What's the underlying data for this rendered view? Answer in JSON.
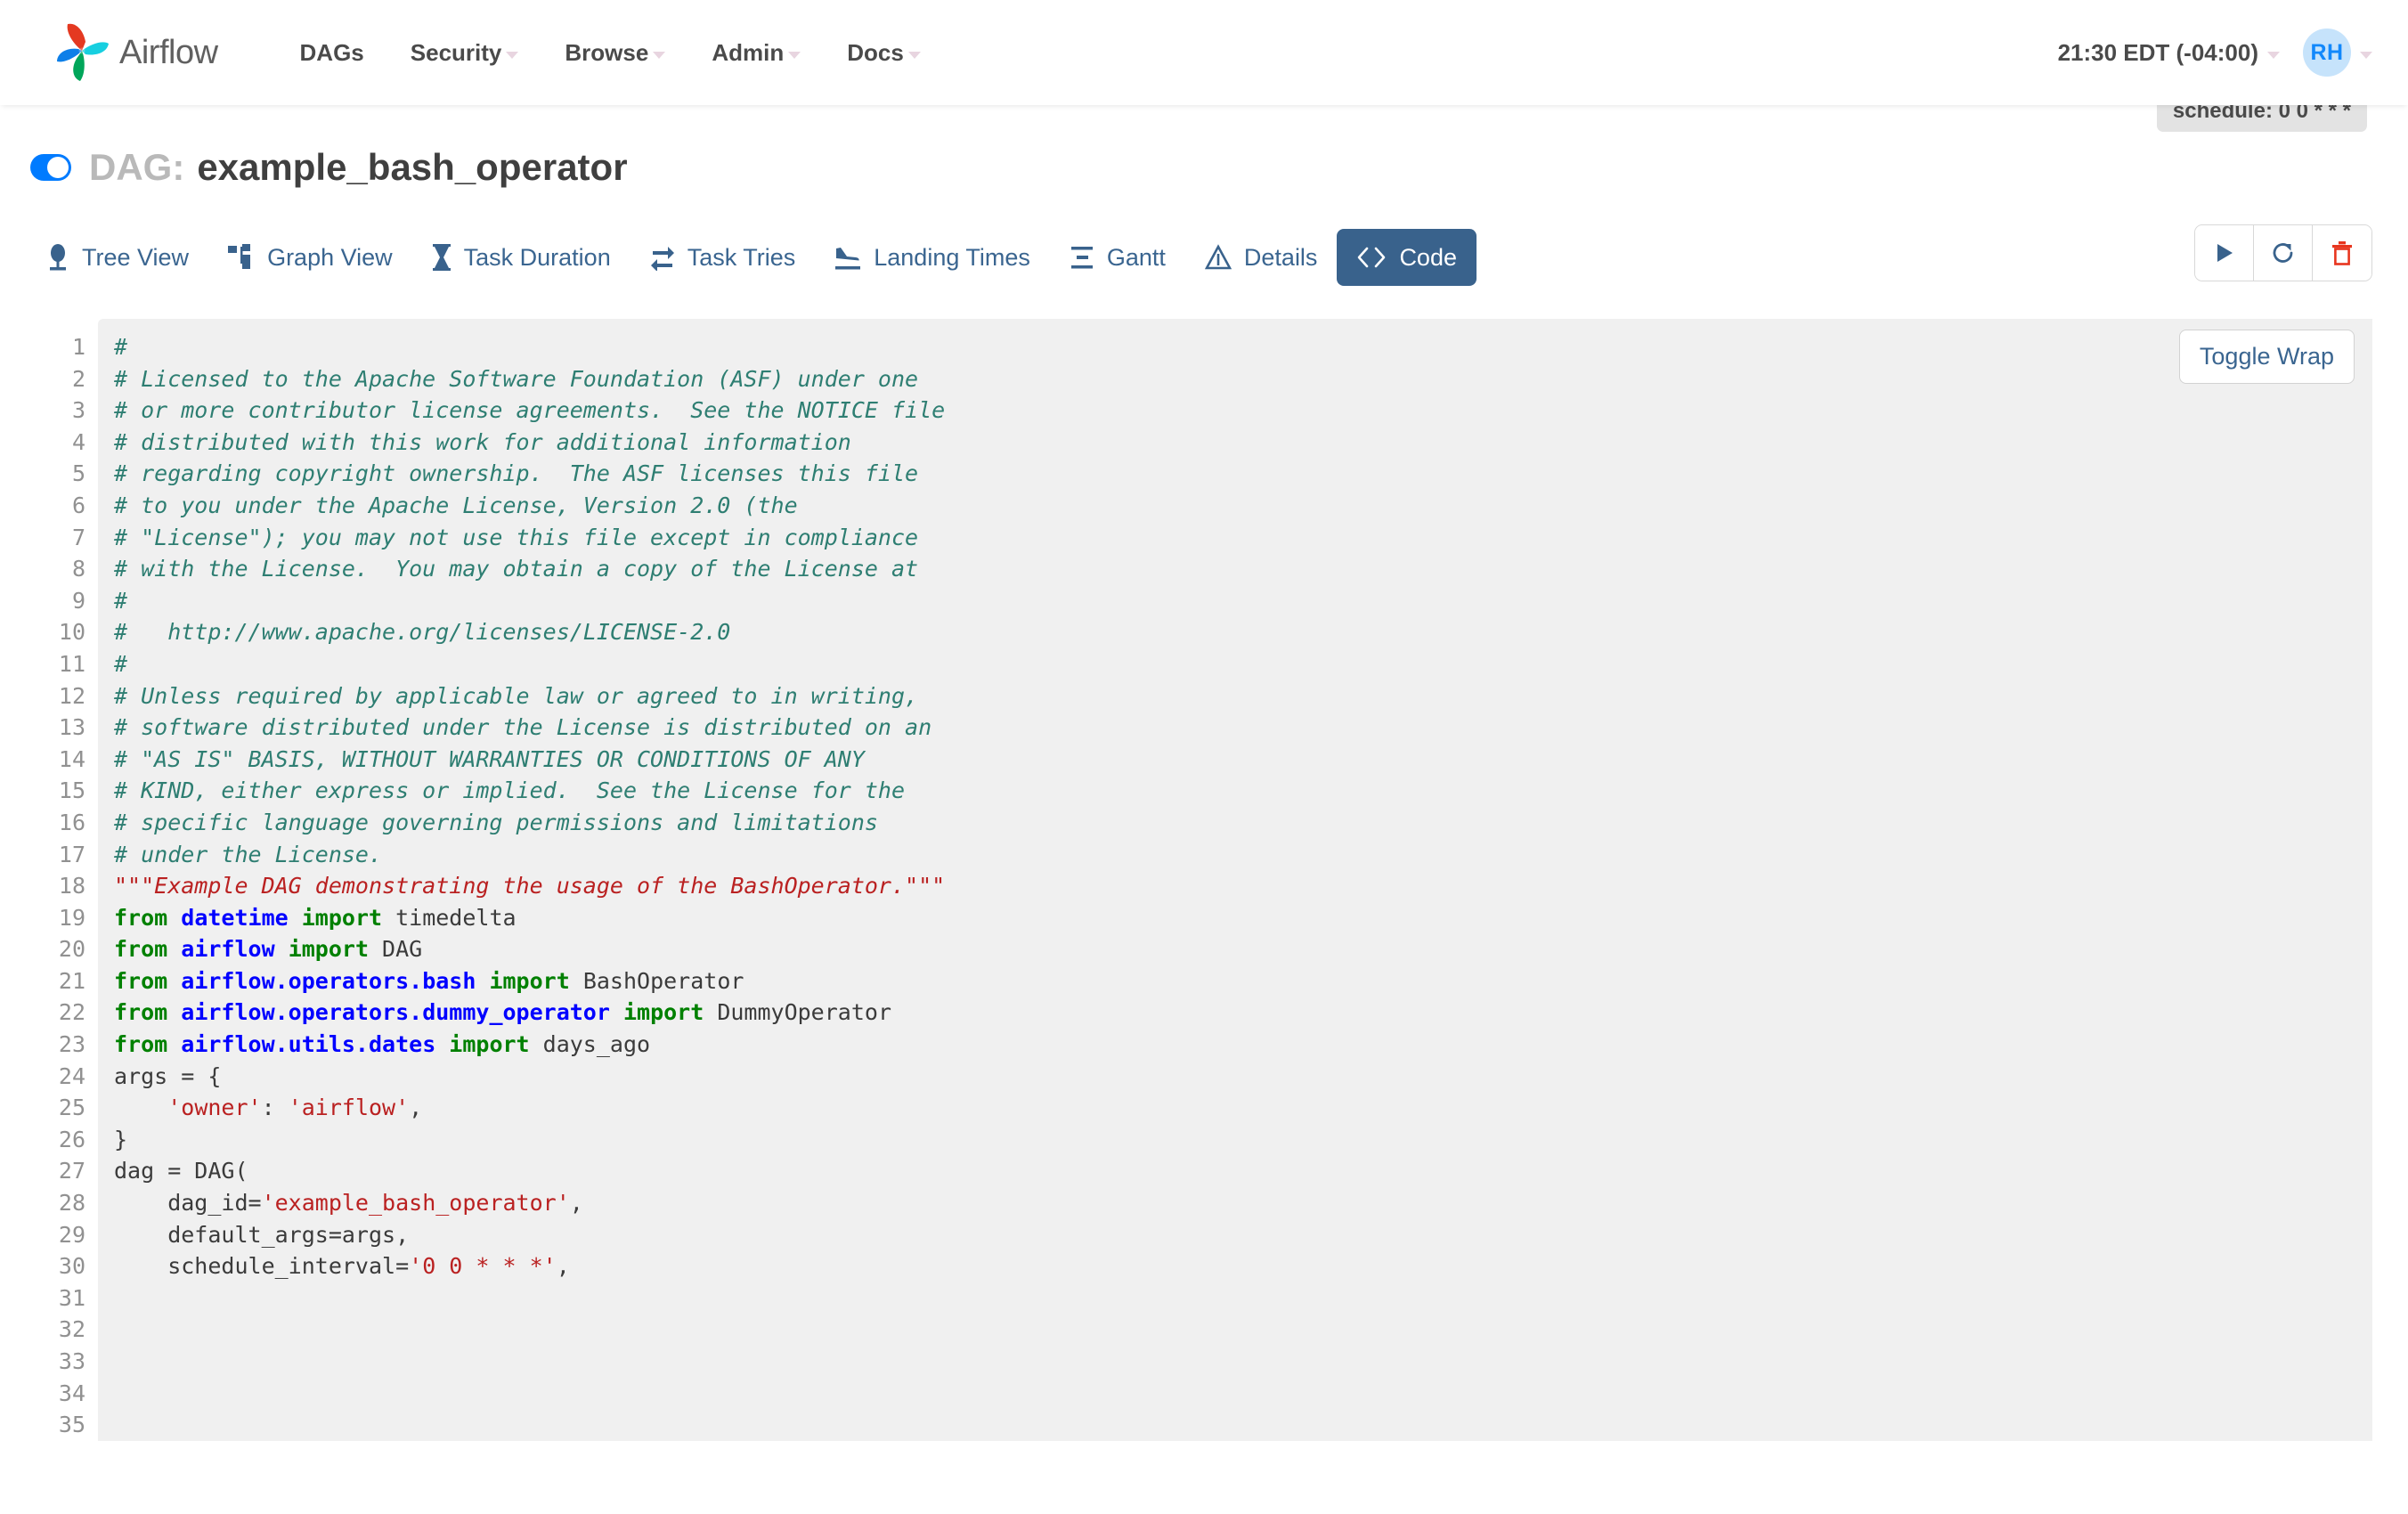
{
  "navbar": {
    "brand": "Airflow",
    "links": [
      {
        "label": "DAGs",
        "has_caret": false
      },
      {
        "label": "Security",
        "has_caret": true
      },
      {
        "label": "Browse",
        "has_caret": true
      },
      {
        "label": "Admin",
        "has_caret": true
      },
      {
        "label": "Docs",
        "has_caret": true
      }
    ],
    "timezone": "21:30 EDT (-04:00)",
    "avatar_initials": "RH"
  },
  "dag": {
    "prefix": "DAG:",
    "name": "example_bash_operator",
    "toggle_on": true,
    "schedule_badge": "schedule: 0 0 * * *"
  },
  "tabs": [
    {
      "label": "Tree View",
      "icon": "tree-icon",
      "active": false
    },
    {
      "label": "Graph View",
      "icon": "graph-icon",
      "active": false
    },
    {
      "label": "Task Duration",
      "icon": "hourglass-icon",
      "active": false
    },
    {
      "label": "Task Tries",
      "icon": "retry-icon",
      "active": false
    },
    {
      "label": "Landing Times",
      "icon": "plane-landing-icon",
      "active": false
    },
    {
      "label": "Gantt",
      "icon": "gantt-icon",
      "active": false
    },
    {
      "label": "Details",
      "icon": "warning-triangle-icon",
      "active": false
    },
    {
      "label": "Code",
      "icon": "code-brackets-icon",
      "active": true
    }
  ],
  "actions": [
    {
      "name": "trigger-dag-button",
      "icon": "play-icon",
      "color": "#39628c"
    },
    {
      "name": "refresh-button",
      "icon": "refresh-icon",
      "color": "#39628c"
    },
    {
      "name": "delete-dag-button",
      "icon": "trash-icon",
      "color": "#e8351e"
    }
  ],
  "code_panel": {
    "toggle_wrap_label": "Toggle Wrap",
    "first_line_number": 1,
    "last_line_number": 35,
    "lines": [
      {
        "n": 1,
        "tokens": [
          {
            "t": "#",
            "c": "c"
          }
        ]
      },
      {
        "n": 2,
        "tokens": [
          {
            "t": "# Licensed to the Apache Software Foundation (ASF) under one",
            "c": "c"
          }
        ]
      },
      {
        "n": 3,
        "tokens": [
          {
            "t": "# or more contributor license agreements.  See the NOTICE file",
            "c": "c"
          }
        ]
      },
      {
        "n": 4,
        "tokens": [
          {
            "t": "# distributed with this work for additional information",
            "c": "c"
          }
        ]
      },
      {
        "n": 5,
        "tokens": [
          {
            "t": "# regarding copyright ownership.  The ASF licenses this file",
            "c": "c"
          }
        ]
      },
      {
        "n": 6,
        "tokens": [
          {
            "t": "# to you under the Apache License, Version 2.0 (the",
            "c": "c"
          }
        ]
      },
      {
        "n": 7,
        "tokens": [
          {
            "t": "# \"License\"); you may not use this file except in compliance",
            "c": "c"
          }
        ]
      },
      {
        "n": 8,
        "tokens": [
          {
            "t": "# with the License.  You may obtain a copy of the License at",
            "c": "c"
          }
        ]
      },
      {
        "n": 9,
        "tokens": [
          {
            "t": "#",
            "c": "c"
          }
        ]
      },
      {
        "n": 10,
        "tokens": [
          {
            "t": "#   http://www.apache.org/licenses/LICENSE-2.0",
            "c": "c"
          }
        ]
      },
      {
        "n": 11,
        "tokens": [
          {
            "t": "#",
            "c": "c"
          }
        ]
      },
      {
        "n": 12,
        "tokens": [
          {
            "t": "# Unless required by applicable law or agreed to in writing,",
            "c": "c"
          }
        ]
      },
      {
        "n": 13,
        "tokens": [
          {
            "t": "# software distributed under the License is distributed on an",
            "c": "c"
          }
        ]
      },
      {
        "n": 14,
        "tokens": [
          {
            "t": "# \"AS IS\" BASIS, WITHOUT WARRANTIES OR CONDITIONS OF ANY",
            "c": "c"
          }
        ]
      },
      {
        "n": 15,
        "tokens": [
          {
            "t": "# KIND, either express or implied.  See the License for the",
            "c": "c"
          }
        ]
      },
      {
        "n": 16,
        "tokens": [
          {
            "t": "# specific language governing permissions and limitations",
            "c": "c"
          }
        ]
      },
      {
        "n": 17,
        "tokens": [
          {
            "t": "# under the License.",
            "c": "c"
          }
        ]
      },
      {
        "n": 18,
        "tokens": [
          {
            "t": "",
            "c": "n"
          }
        ]
      },
      {
        "n": 19,
        "tokens": [
          {
            "t": "\"\"\"Example DAG demonstrating the usage of the BashOperator.\"\"\"",
            "c": "ds"
          }
        ]
      },
      {
        "n": 20,
        "tokens": [
          {
            "t": "",
            "c": "n"
          }
        ]
      },
      {
        "n": 21,
        "tokens": [
          {
            "t": "from ",
            "c": "k"
          },
          {
            "t": "datetime ",
            "c": "nn"
          },
          {
            "t": "import ",
            "c": "k"
          },
          {
            "t": "timedelta",
            "c": "n"
          }
        ]
      },
      {
        "n": 22,
        "tokens": [
          {
            "t": "",
            "c": "n"
          }
        ]
      },
      {
        "n": 23,
        "tokens": [
          {
            "t": "from ",
            "c": "k"
          },
          {
            "t": "airflow ",
            "c": "nn"
          },
          {
            "t": "import ",
            "c": "k"
          },
          {
            "t": "DAG",
            "c": "n"
          }
        ]
      },
      {
        "n": 24,
        "tokens": [
          {
            "t": "from ",
            "c": "k"
          },
          {
            "t": "airflow.operators.bash ",
            "c": "nn"
          },
          {
            "t": "import ",
            "c": "k"
          },
          {
            "t": "BashOperator",
            "c": "n"
          }
        ]
      },
      {
        "n": 25,
        "tokens": [
          {
            "t": "from ",
            "c": "k"
          },
          {
            "t": "airflow.operators.dummy_operator ",
            "c": "nn"
          },
          {
            "t": "import ",
            "c": "k"
          },
          {
            "t": "DummyOperator",
            "c": "n"
          }
        ]
      },
      {
        "n": 26,
        "tokens": [
          {
            "t": "from ",
            "c": "k"
          },
          {
            "t": "airflow.utils.dates ",
            "c": "nn"
          },
          {
            "t": "import ",
            "c": "k"
          },
          {
            "t": "days_ago",
            "c": "n"
          }
        ]
      },
      {
        "n": 27,
        "tokens": [
          {
            "t": "",
            "c": "n"
          }
        ]
      },
      {
        "n": 28,
        "tokens": [
          {
            "t": "args = {",
            "c": "n"
          }
        ]
      },
      {
        "n": 29,
        "tokens": [
          {
            "t": "    ",
            "c": "n"
          },
          {
            "t": "'owner'",
            "c": "s"
          },
          {
            "t": ": ",
            "c": "n"
          },
          {
            "t": "'airflow'",
            "c": "s"
          },
          {
            "t": ",",
            "c": "n"
          }
        ]
      },
      {
        "n": 30,
        "tokens": [
          {
            "t": "}",
            "c": "n"
          }
        ]
      },
      {
        "n": 31,
        "tokens": [
          {
            "t": "",
            "c": "n"
          }
        ]
      },
      {
        "n": 32,
        "tokens": [
          {
            "t": "dag = DAG(",
            "c": "n"
          }
        ]
      },
      {
        "n": 33,
        "tokens": [
          {
            "t": "    dag_id=",
            "c": "n"
          },
          {
            "t": "'example_bash_operator'",
            "c": "s"
          },
          {
            "t": ",",
            "c": "n"
          }
        ]
      },
      {
        "n": 34,
        "tokens": [
          {
            "t": "    default_args=args,",
            "c": "n"
          }
        ]
      },
      {
        "n": 35,
        "tokens": [
          {
            "t": "    schedule_interval=",
            "c": "n"
          },
          {
            "t": "'0 0 * * *'",
            "c": "s"
          },
          {
            "t": ",",
            "c": "n"
          }
        ]
      }
    ]
  }
}
